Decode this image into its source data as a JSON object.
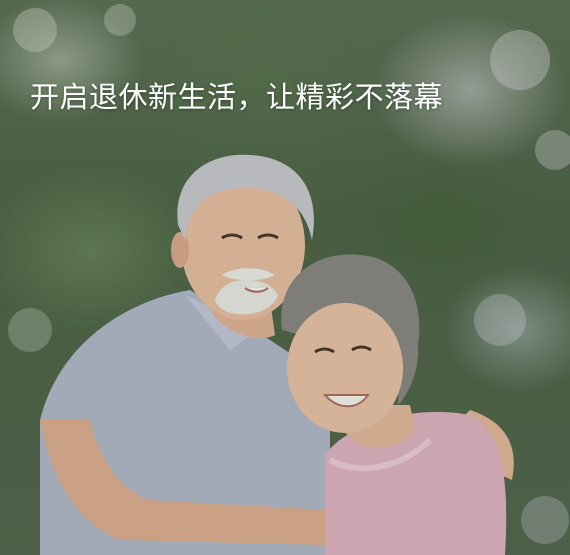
{
  "hero": {
    "headline": "开启退休新生活，让精彩不落幕",
    "photo_subject": "elderly-couple-embracing"
  },
  "colors": {
    "headline_text": "#ffffff",
    "background_foliage": "#55694f",
    "man_shirt": "#b9bdd0",
    "woman_sweater": "#e8b9c8"
  }
}
